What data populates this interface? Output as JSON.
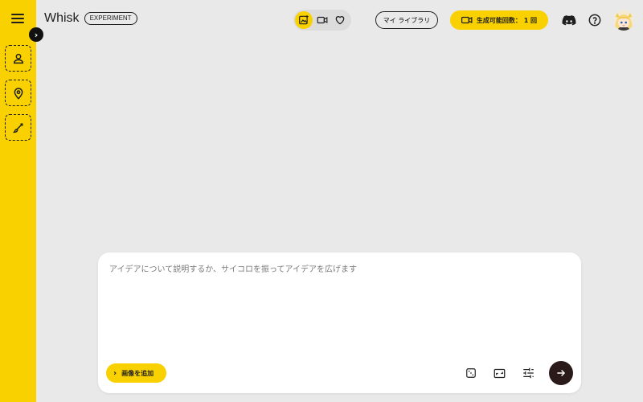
{
  "header": {
    "brand_title": "Whisk",
    "brand_badge": "EXPERIMENT",
    "library_label": "マイ ライブラリ",
    "generations_label": "生成可能回数： 1 回"
  },
  "sidebar": {
    "slots": [
      {
        "icon": "person-icon"
      },
      {
        "icon": "location-pin-icon"
      },
      {
        "icon": "brush-icon"
      }
    ]
  },
  "modes": [
    {
      "icon": "image-mode-icon",
      "active": true
    },
    {
      "icon": "video-mode-icon",
      "active": false
    },
    {
      "icon": "heart-icon",
      "active": false
    }
  ],
  "prompt": {
    "placeholder": "アイデアについて説明するか、サイコロを振ってアイデアを広げます",
    "value": ""
  },
  "actions": {
    "add_image_label": "画像を追加"
  },
  "colors": {
    "accent": "#f9d100",
    "background": "#e9e9e9",
    "submit": "#2b1a1a"
  }
}
